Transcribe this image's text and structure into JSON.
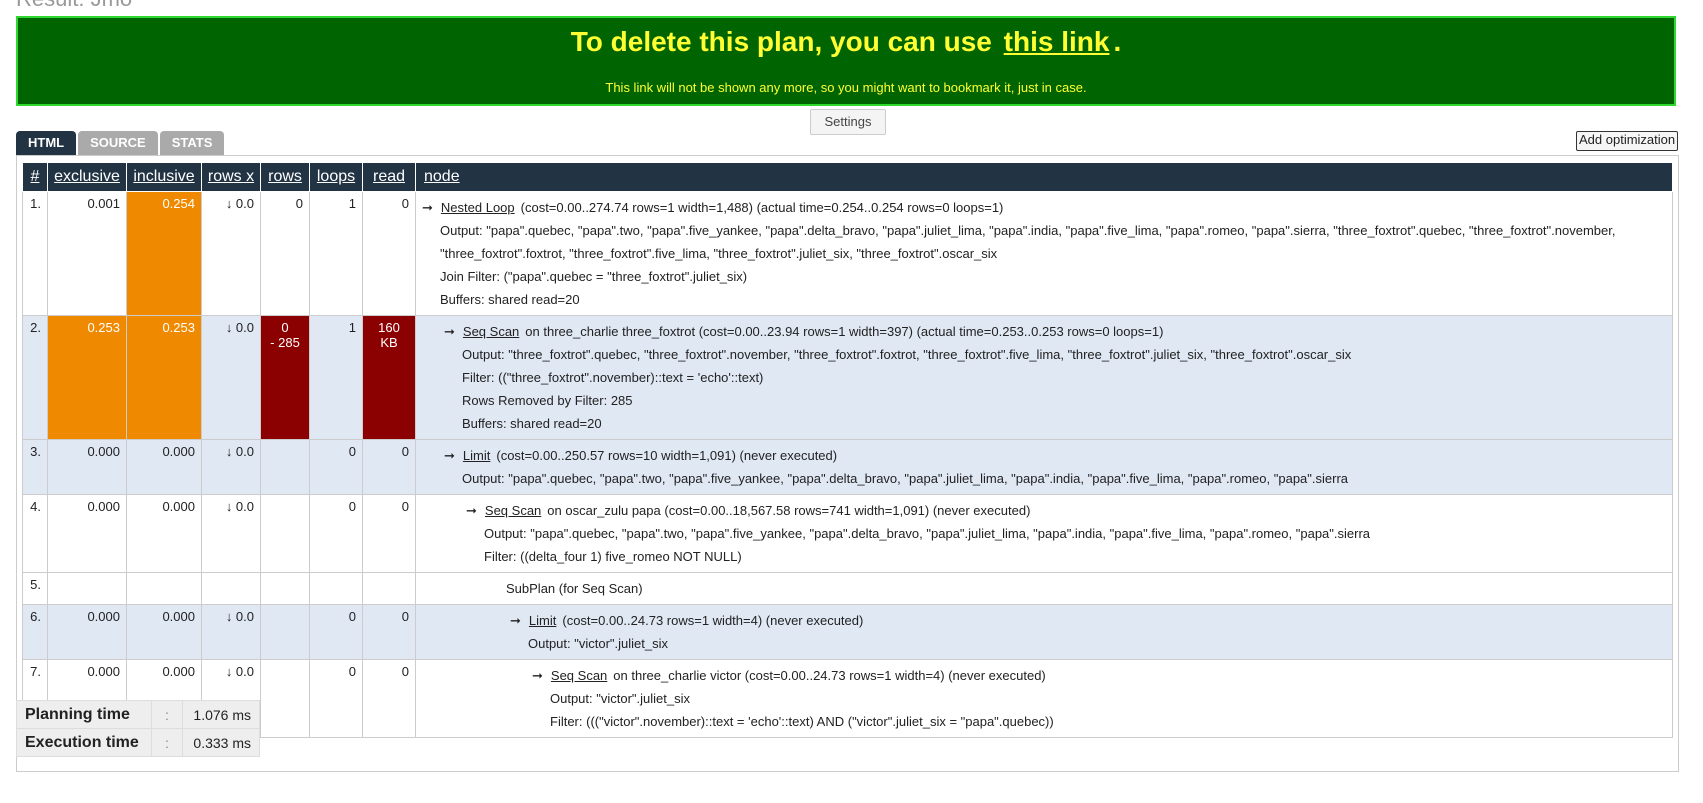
{
  "result_title": "Result: Jmo",
  "banner": {
    "text_before": "To delete this plan, you can use",
    "link_text": "this link",
    "text_after": ".",
    "note": "This link will not be shown any more, so you might want to bookmark it, just in case."
  },
  "settings_label": "Settings",
  "tabs": [
    "HTML",
    "SOURCE",
    "STATS"
  ],
  "add_optimization_label": "Add optimization",
  "columns": [
    "#",
    "exclusive",
    "inclusive",
    "rows x",
    "rows",
    "loops",
    "read",
    "node"
  ],
  "rows": [
    {
      "num": "1.",
      "exclusive": "0.001",
      "inclusive": "0.254",
      "rowsx": "↓ 0.0",
      "rows": "0",
      "rows_sub": "",
      "loops": "1",
      "read": "0",
      "read_sub": "",
      "node_name": "Nested Loop",
      "node_rest": "(cost=0.00..274.74 rows=1 width=1,488) (actual time=0.254..0.254 rows=0 loops=1)",
      "details": [
        "Output: \"papa\".quebec, \"papa\".two, \"papa\".five_yankee, \"papa\".delta_bravo, \"papa\".juliet_lima, \"papa\".india, \"papa\".five_lima, \"papa\".romeo, \"papa\".sierra, \"three_foxtrot\".quebec, \"three_foxtrot\".november, \"three_foxtrot\".foxtrot, \"three_foxtrot\".five_lima, \"three_foxtrot\".juliet_six, \"three_foxtrot\".oscar_six",
        "Join Filter: (\"papa\".quebec = \"three_foxtrot\".juliet_six)",
        "Buffers: shared read=20"
      ]
    },
    {
      "num": "2.",
      "exclusive": "0.253",
      "inclusive": "0.253",
      "rowsx": "↓ 0.0",
      "rows": "0",
      "rows_sub": "- 285",
      "loops": "1",
      "read": "160",
      "read_sub": "KB",
      "node_name": "Seq Scan",
      "node_rest": "on three_charlie three_foxtrot (cost=0.00..23.94 rows=1 width=397) (actual time=0.253..0.253 rows=0 loops=1)",
      "details": [
        "Output: \"three_foxtrot\".quebec, \"three_foxtrot\".november, \"three_foxtrot\".foxtrot, \"three_foxtrot\".five_lima, \"three_foxtrot\".juliet_six, \"three_foxtrot\".oscar_six",
        "Filter: ((\"three_foxtrot\".november)::text = 'echo'::text)",
        "Rows Removed by Filter: 285",
        "Buffers: shared read=20"
      ]
    },
    {
      "num": "3.",
      "exclusive": "0.000",
      "inclusive": "0.000",
      "rowsx": "↓ 0.0",
      "rows": "",
      "rows_sub": "",
      "loops": "0",
      "read": "0",
      "read_sub": "",
      "node_name": "Limit",
      "node_rest": "(cost=0.00..250.57 rows=10 width=1,091) (never executed)",
      "details": [
        "Output: \"papa\".quebec, \"papa\".two, \"papa\".five_yankee, \"papa\".delta_bravo, \"papa\".juliet_lima, \"papa\".india, \"papa\".five_lima, \"papa\".romeo, \"papa\".sierra"
      ]
    },
    {
      "num": "4.",
      "exclusive": "0.000",
      "inclusive": "0.000",
      "rowsx": "↓ 0.0",
      "rows": "",
      "rows_sub": "",
      "loops": "0",
      "read": "0",
      "read_sub": "",
      "node_name": "Seq Scan",
      "node_rest": "on oscar_zulu papa (cost=0.00..18,567.58 rows=741 width=1,091) (never executed)",
      "details": [
        "Output: \"papa\".quebec, \"papa\".two, \"papa\".five_yankee, \"papa\".delta_bravo, \"papa\".juliet_lima, \"papa\".india, \"papa\".five_lima, \"papa\".romeo, \"papa\".sierra",
        "Filter: ((delta_four 1) five_romeo NOT NULL)"
      ]
    },
    {
      "num": "5.",
      "exclusive": "",
      "inclusive": "",
      "rowsx": "",
      "rows": "",
      "rows_sub": "",
      "loops": "",
      "read": "",
      "read_sub": "",
      "node_name": "",
      "node_rest": "SubPlan (for Seq Scan)",
      "details": []
    },
    {
      "num": "6.",
      "exclusive": "0.000",
      "inclusive": "0.000",
      "rowsx": "↓ 0.0",
      "rows": "",
      "rows_sub": "",
      "loops": "0",
      "read": "0",
      "read_sub": "",
      "node_name": "Limit",
      "node_rest": "(cost=0.00..24.73 rows=1 width=4) (never executed)",
      "details": [
        "Output: \"victor\".juliet_six"
      ]
    },
    {
      "num": "7.",
      "exclusive": "0.000",
      "inclusive": "0.000",
      "rowsx": "↓ 0.0",
      "rows": "",
      "rows_sub": "",
      "loops": "0",
      "read": "0",
      "read_sub": "",
      "node_name": "Seq Scan",
      "node_rest": "on three_charlie victor (cost=0.00..24.73 rows=1 width=4) (never executed)",
      "details": [
        "Output: \"victor\".juliet_six",
        "Filter: (((\"victor\".november)::text = 'echo'::text) AND (\"victor\".juliet_six = \"papa\".quebec))"
      ]
    }
  ],
  "planning_time": {
    "label": "Planning time",
    "sep": ":",
    "value": "1.076 ms"
  },
  "execution_time": {
    "label": "Execution time",
    "sep": ":",
    "value": "0.333 ms"
  }
}
